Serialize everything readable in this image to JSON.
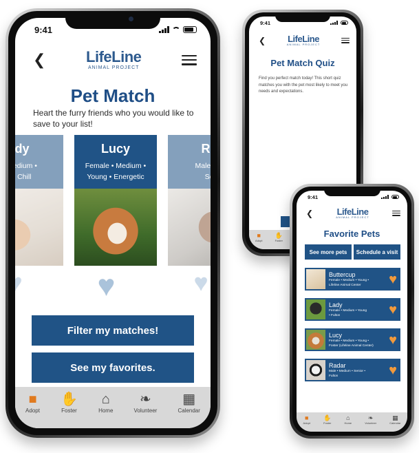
{
  "status": {
    "time": "9:41"
  },
  "logo": {
    "line1": "LifeLine",
    "line2": "ANIMAL PROJECT"
  },
  "icons": {
    "back": "chevron-left-icon",
    "menu": "hamburger-menu-icon",
    "heart": "heart-icon"
  },
  "colors": {
    "primary": "#205386",
    "accent": "#f29a3c",
    "tabbar": "#d8d8d8"
  },
  "tabs": [
    {
      "label": "Adopt",
      "icon": "adopt-icon"
    },
    {
      "label": "Foster",
      "icon": "foster-icon"
    },
    {
      "label": "Home",
      "icon": "home-icon"
    },
    {
      "label": "Volunteer",
      "icon": "volunteer-icon"
    },
    {
      "label": "Calendar",
      "icon": "calendar-icon"
    }
  ],
  "match": {
    "title": "Pet Match",
    "subtitle": "Heart the furry friends who you would like to save to your list!",
    "cards": [
      {
        "name": "dy",
        "traits1": "Medium •",
        "traits2": "• Chill"
      },
      {
        "name": "Lucy",
        "traits1": "Female • Medium •",
        "traits2": "Young • Energetic"
      },
      {
        "name": "Ra",
        "traits1": "Male • M",
        "traits2": "Se"
      }
    ],
    "buttons": {
      "filter": "Filter my matches!",
      "favorites": "See my favorites."
    }
  },
  "quiz": {
    "title": "Pet Match Quiz",
    "text": "Find you perfect match today! This short quiz matches you with the pet most likely to meet you needs and expectations."
  },
  "favorites": {
    "title": "Favorite Pets",
    "buttons": {
      "more": "See more pets",
      "visit": "Schedule a visit"
    },
    "pets": [
      {
        "name": "Buttercup",
        "line1": "Female • Medium • Young •",
        "line2": "Lifeline Animal Center"
      },
      {
        "name": "Lady",
        "line1": "Female • Medium • Young",
        "line2": "• Fulton"
      },
      {
        "name": "Lucy",
        "line1": "Female • Medium • Young •",
        "line2": "Foster (Lifeline Animal Center)"
      },
      {
        "name": "Radar",
        "line1": "Male • Medium • Senior •",
        "line2": "Fulton"
      }
    ]
  }
}
